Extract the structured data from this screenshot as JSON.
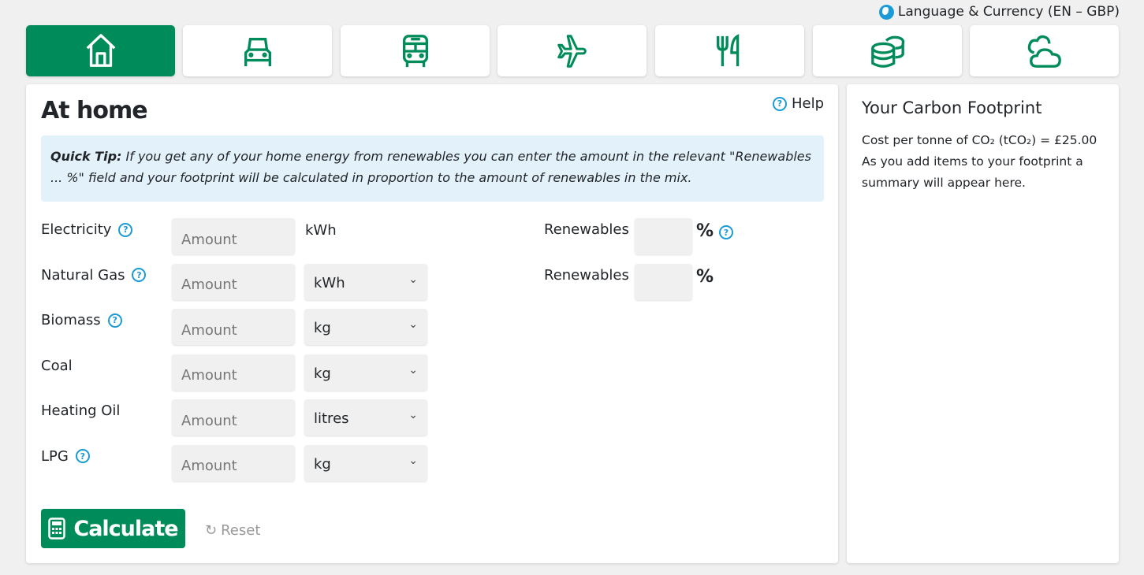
{
  "header": {
    "language_currency": "Language & Currency (EN – GBP)",
    "globe_icon": "globe-icon"
  },
  "tabs": [
    {
      "name": "home",
      "icon": "home-icon",
      "active": true
    },
    {
      "name": "car",
      "icon": "car-icon",
      "active": false
    },
    {
      "name": "bus",
      "icon": "bus-icon",
      "active": false
    },
    {
      "name": "flight",
      "icon": "plane-icon",
      "active": false
    },
    {
      "name": "food",
      "icon": "utensils-icon",
      "active": false
    },
    {
      "name": "spending",
      "icon": "coins-icon",
      "active": false
    },
    {
      "name": "offset",
      "icon": "cloud-icon",
      "active": false
    }
  ],
  "main": {
    "title": "At home",
    "help": "Help",
    "tip_label": "Quick Tip:",
    "tip_text": " If you get any of your home energy from renewables you can enter the amount in the relevant \"Renewables ... %\" field and your footprint will be calculated in proportion to the amount of renewables in the mix.",
    "rows": [
      {
        "label": "Electricity",
        "help": true,
        "placeholder": "Amount",
        "unit": "kWh",
        "unit_select": false
      },
      {
        "label": "Natural Gas",
        "help": true,
        "placeholder": "Amount",
        "unit": "kWh",
        "unit_select": true
      },
      {
        "label": "Biomass",
        "help": true,
        "placeholder": "Amount",
        "unit": "kg",
        "unit_select": true
      },
      {
        "label": "Coal",
        "help": false,
        "placeholder": "Amount",
        "unit": "kg",
        "unit_select": true
      },
      {
        "label": "Heating Oil",
        "help": false,
        "placeholder": "Amount",
        "unit": "litres",
        "unit_select": true
      },
      {
        "label": "LPG",
        "help": true,
        "placeholder": "Amount",
        "unit": "kg",
        "unit_select": true
      }
    ],
    "renewables": [
      {
        "label": "Renewables",
        "suffix": "%"
      },
      {
        "label": "Renewables",
        "suffix": "%"
      }
    ],
    "calculate": "Calculate",
    "reset": "Reset"
  },
  "sidebar": {
    "title": "Your Carbon Footprint",
    "cost_line": "Cost per tonne of CO₂ (tCO₂) = £25.00",
    "summary": "As you add items to your footprint a summary will appear here."
  },
  "colors": {
    "brand_green": "#008c5a",
    "help_blue": "#1a9bd7",
    "tip_bg": "#e3f2fa"
  }
}
